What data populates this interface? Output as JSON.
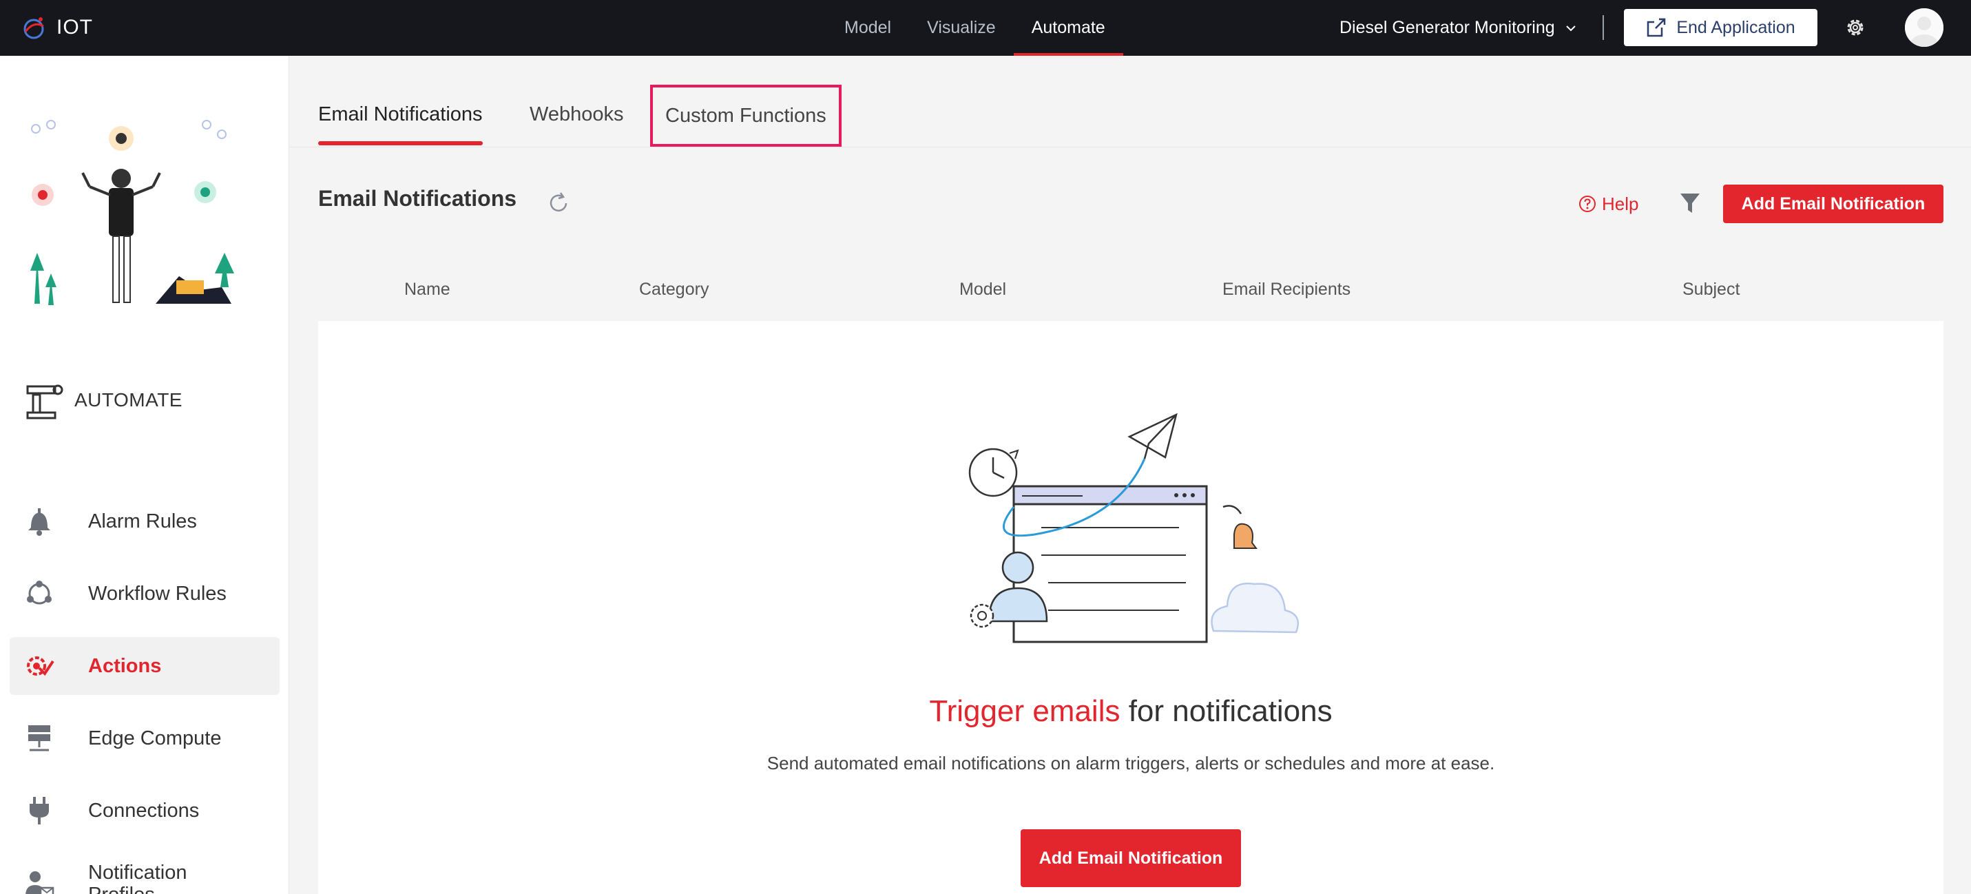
{
  "app": {
    "name": "IOT"
  },
  "topnav": {
    "items": [
      {
        "label": "Model"
      },
      {
        "label": "Visualize"
      },
      {
        "label": "Automate",
        "active": true
      }
    ]
  },
  "application_selector": {
    "value": "Diesel Generator Monitoring"
  },
  "end_application": {
    "label": "End Application"
  },
  "sidebar": {
    "heading": "AUTOMATE",
    "items": [
      {
        "label": "Alarm Rules"
      },
      {
        "label": "Workflow Rules"
      },
      {
        "label": "Actions",
        "active": true
      },
      {
        "label": "Edge Compute"
      },
      {
        "label": "Connections"
      },
      {
        "label": "Notification Profiles"
      }
    ]
  },
  "tabs": [
    {
      "label": "Email Notifications",
      "active": true
    },
    {
      "label": "Webhooks"
    },
    {
      "label": "Custom Functions",
      "highlighted": true
    }
  ],
  "toolbar": {
    "title": "Email Notifications",
    "help_label": "Help",
    "add_label": "Add Email Notification"
  },
  "table": {
    "columns": [
      "Name",
      "Category",
      "Model",
      "Email Recipients",
      "Subject"
    ]
  },
  "empty_state": {
    "title_highlight": "Trigger emails",
    "title_rest": " for notifications",
    "description": "Send automated email notifications on alarm triggers, alerts or schedules and more at ease.",
    "button_label": "Add Email Notification"
  },
  "colors": {
    "accent": "#e3262d",
    "topbar": "#15171c",
    "tab_highlight_border": "#e8195c"
  }
}
